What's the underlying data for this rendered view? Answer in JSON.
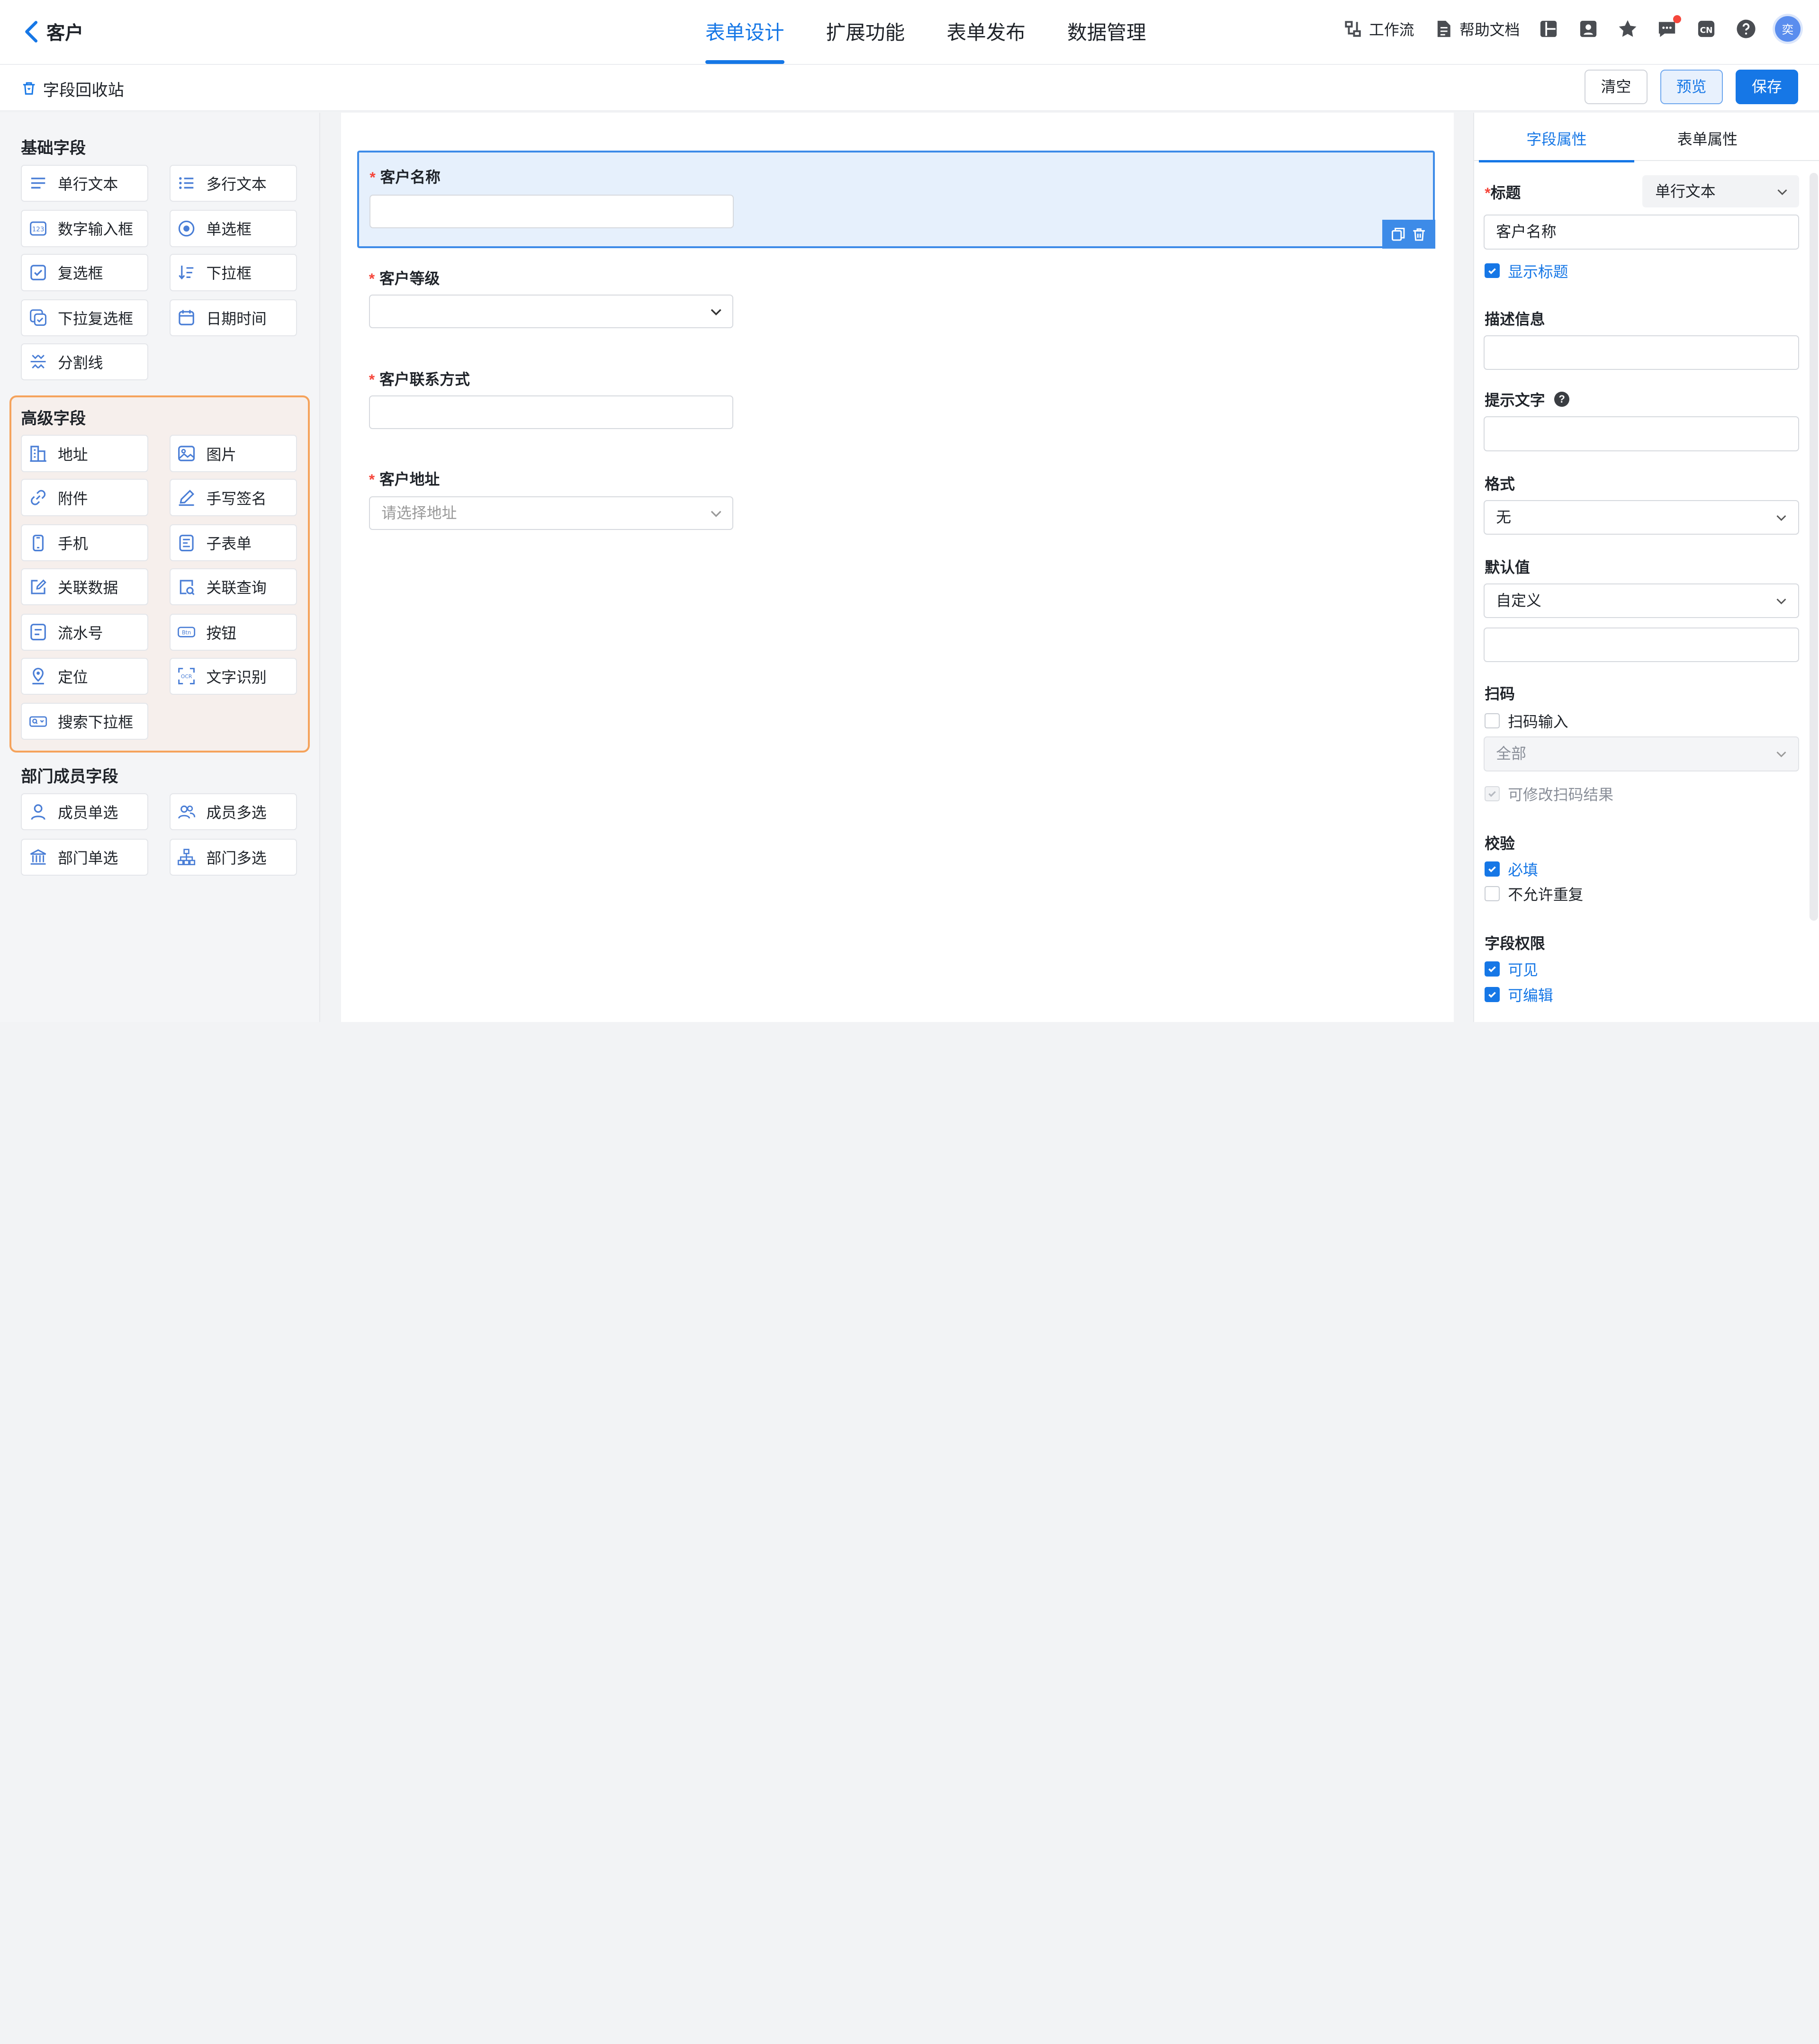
{
  "header": {
    "back_title": "客户",
    "tabs": [
      {
        "label": "表单设计",
        "active": true
      },
      {
        "label": "扩展功能",
        "active": false
      },
      {
        "label": "表单发布",
        "active": false
      },
      {
        "label": "数据管理",
        "active": false
      }
    ],
    "workflow_label": "工作流",
    "help_label": "帮助文档",
    "avatar_text": "奕"
  },
  "subbar": {
    "recycle_label": "字段回收站",
    "clear_label": "清空",
    "preview_label": "预览",
    "save_label": "保存"
  },
  "left_panel": {
    "basic_title": "基础字段",
    "basic_items": [
      {
        "label": "单行文本",
        "icon": "lines-icon"
      },
      {
        "label": "多行文本",
        "icon": "list-icon"
      },
      {
        "label": "数字输入框",
        "icon": "number-icon"
      },
      {
        "label": "单选框",
        "icon": "radio-icon"
      },
      {
        "label": "复选框",
        "icon": "checkbox-icon"
      },
      {
        "label": "下拉框",
        "icon": "sort-icon"
      },
      {
        "label": "下拉复选框",
        "icon": "multi-select-icon"
      },
      {
        "label": "日期时间",
        "icon": "calendar-icon"
      },
      {
        "label": "分割线",
        "icon": "divider-icon"
      }
    ],
    "advanced_title": "高级字段",
    "advanced_items": [
      {
        "label": "地址",
        "icon": "building-icon"
      },
      {
        "label": "图片",
        "icon": "image-icon"
      },
      {
        "label": "附件",
        "icon": "link-icon"
      },
      {
        "label": "手写签名",
        "icon": "pen-icon"
      },
      {
        "label": "手机",
        "icon": "phone-icon"
      },
      {
        "label": "子表单",
        "icon": "subform-icon"
      },
      {
        "label": "关联数据",
        "icon": "edit-doc-icon"
      },
      {
        "label": "关联查询",
        "icon": "search-doc-icon"
      },
      {
        "label": "流水号",
        "icon": "serial-icon"
      },
      {
        "label": "按钮",
        "icon": "button-icon"
      },
      {
        "label": "定位",
        "icon": "location-icon"
      },
      {
        "label": "文字识别",
        "icon": "ocr-icon"
      },
      {
        "label": "搜索下拉框",
        "icon": "search-select-icon"
      }
    ],
    "member_title": "部门成员字段",
    "member_items": [
      {
        "label": "成员单选",
        "icon": "user-icon"
      },
      {
        "label": "成员多选",
        "icon": "users-icon"
      },
      {
        "label": "部门单选",
        "icon": "bank-icon"
      },
      {
        "label": "部门多选",
        "icon": "org-icon"
      }
    ]
  },
  "canvas": {
    "fields": [
      {
        "label": "客户名称",
        "required": true,
        "type": "text",
        "value": ""
      },
      {
        "label": "客户等级",
        "required": true,
        "type": "select",
        "value": ""
      },
      {
        "label": "客户联系方式",
        "required": true,
        "type": "text",
        "value": ""
      },
      {
        "label": "客户地址",
        "required": true,
        "type": "select",
        "placeholder": "请选择地址"
      }
    ]
  },
  "right_panel": {
    "tabs": [
      {
        "label": "字段属性",
        "active": true
      },
      {
        "label": "表单属性",
        "active": false
      }
    ],
    "title_label": "标题",
    "field_type": "单行文本",
    "title_value": "客户名称",
    "show_title_label": "显示标题",
    "show_title_checked": true,
    "desc_label": "描述信息",
    "desc_value": "",
    "hint_label": "提示文字",
    "hint_value": "",
    "format_label": "格式",
    "format_value": "无",
    "default_label": "默认值",
    "default_mode": "自定义",
    "default_value": "",
    "scan_label": "扫码",
    "scan_input_label": "扫码输入",
    "scan_input_checked": false,
    "scan_scope": "全部",
    "scan_editable_label": "可修改扫码结果",
    "validate_label": "校验",
    "required_label": "必填",
    "required_checked": true,
    "no_dup_label": "不允许重复",
    "no_dup_checked": false,
    "perm_label": "字段权限",
    "visible_label": "可见",
    "visible_checked": true,
    "editable_label": "可编辑",
    "editable_checked": true
  }
}
